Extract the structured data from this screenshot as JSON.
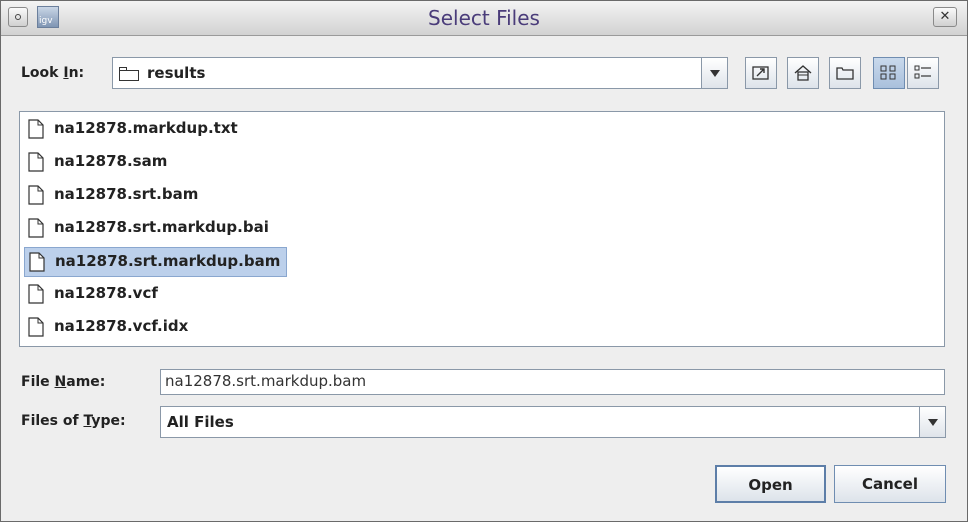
{
  "window": {
    "title": "Select Files",
    "app_icon_text": "igv"
  },
  "look_in": {
    "label_prefix": "Look ",
    "label_mnemonic": "I",
    "label_suffix": "n:",
    "value": "results"
  },
  "toolbar": {
    "icons": [
      "up-one-level-icon",
      "home-icon",
      "new-folder-icon",
      "list-view-icon",
      "details-view-icon"
    ]
  },
  "files": [
    {
      "name": "na12878.markdup.txt",
      "selected": false
    },
    {
      "name": "na12878.sam",
      "selected": false
    },
    {
      "name": "na12878.srt.bam",
      "selected": false
    },
    {
      "name": "na12878.srt.markdup.bai",
      "selected": false
    },
    {
      "name": "na12878.srt.markdup.bam",
      "selected": true
    },
    {
      "name": "na12878.vcf",
      "selected": false
    },
    {
      "name": "na12878.vcf.idx",
      "selected": false
    }
  ],
  "file_name": {
    "label_prefix": "File ",
    "label_mnemonic": "N",
    "label_suffix": "ame:",
    "value": "na12878.srt.markdup.bam"
  },
  "file_type": {
    "label_prefix": "Files of ",
    "label_mnemonic": "T",
    "label_suffix": "ype:",
    "value": "All Files"
  },
  "buttons": {
    "open": "Open",
    "cancel": "Cancel"
  },
  "colors": {
    "selection": "#bcd0eb",
    "title_text": "#4a3c7a",
    "background": "#eeeeee"
  }
}
